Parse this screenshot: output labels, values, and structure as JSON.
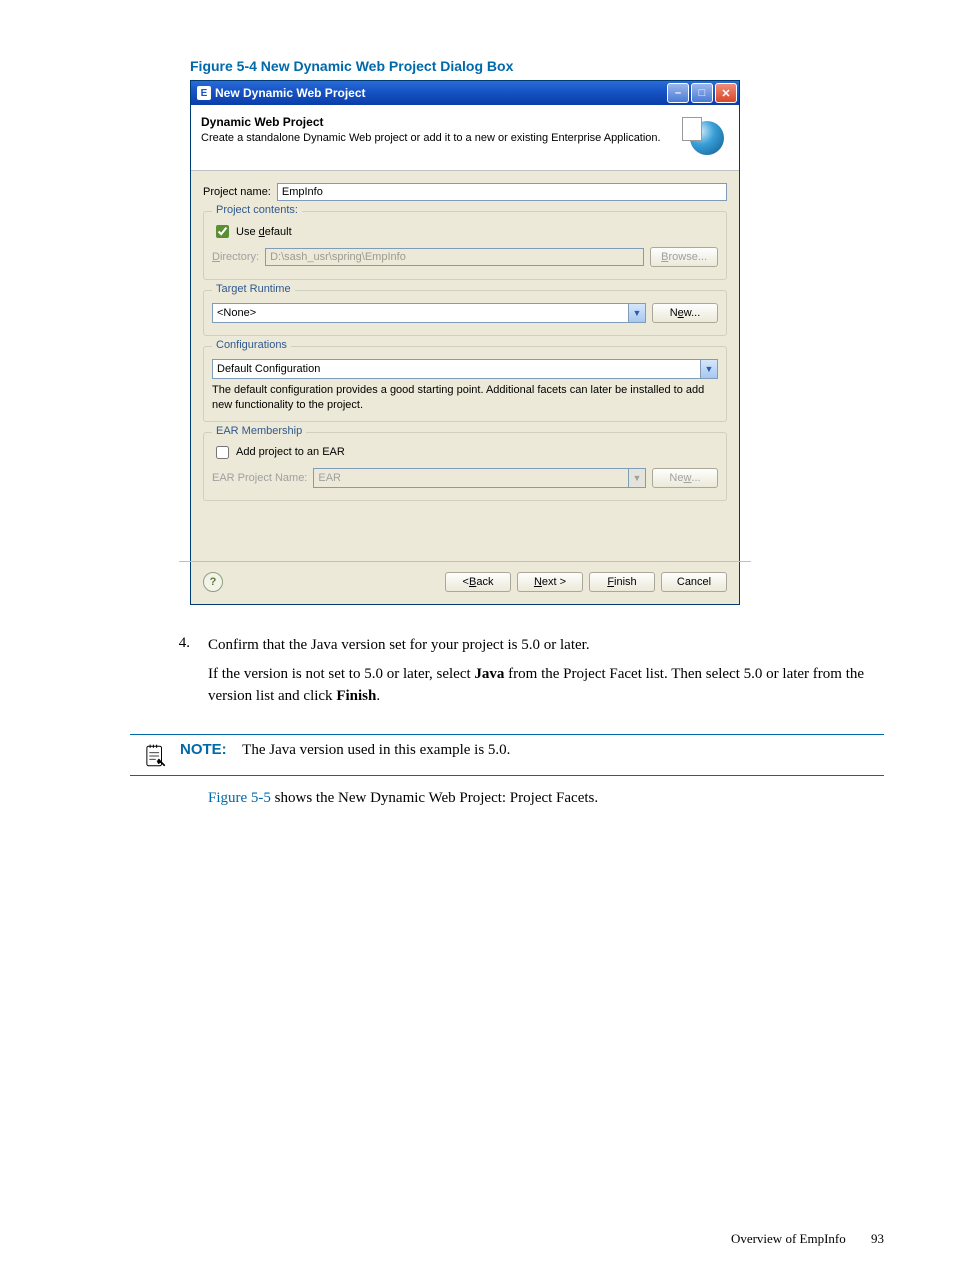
{
  "figure_caption": "Figure 5-4 New Dynamic Web Project Dialog Box",
  "dialog": {
    "window_title": "New Dynamic Web Project",
    "banner": {
      "title": "Dynamic Web Project",
      "desc": "Create a standalone Dynamic Web project or add it to a new or existing Enterprise Application."
    },
    "project_name_label": "Project name:",
    "project_name_value": "EmpInfo",
    "contents": {
      "legend": "Project contents:",
      "use_default_label_pre": "Use ",
      "use_default_label_u": "d",
      "use_default_label_post": "efault",
      "use_default_checked": true,
      "directory_label_u": "D",
      "directory_label_post": "irectory:",
      "directory_value": "D:\\sash_usr\\spring\\EmpInfo",
      "browse_label_u": "B",
      "browse_label_post": "rowse..."
    },
    "runtime": {
      "legend": "Target Runtime",
      "value": "<None>",
      "new_label_pre": "N",
      "new_label_u": "e",
      "new_label_post": "w..."
    },
    "config": {
      "legend": "Configurations",
      "value": "Default Configuration",
      "desc": "The default configuration provides a good starting point. Additional facets can later be installed to add new functionality to the project."
    },
    "ear": {
      "legend": "EAR Membership",
      "add_label": "Add project to an EAR",
      "add_checked": false,
      "name_label": "EAR Project Name:",
      "name_value": "EAR",
      "new_label_pre": "Ne",
      "new_label_u": "w",
      "new_label_post": "..."
    },
    "buttons": {
      "back_pre": "< ",
      "back_u": "B",
      "back_post": "ack",
      "next_u": "N",
      "next_post": "ext >",
      "finish_u": "F",
      "finish_post": "inish",
      "cancel": "Cancel"
    }
  },
  "step": {
    "num": "4.",
    "line1": "Confirm that the Java version set for your project is 5.0 or later.",
    "line2a": "If the version is not set to 5.0 or later, select ",
    "line2b": "Java",
    "line2c": " from the Project Facet list. Then select 5.0 or later from the version list and click ",
    "line2d": "Finish",
    "line2e": "."
  },
  "note": {
    "label": "NOTE:",
    "text": "The Java version used in this example is 5.0."
  },
  "after_note_ref": "Figure 5-5",
  "after_note_rest": " shows the New Dynamic Web Project: Project Facets.",
  "footer": {
    "section": "Overview of EmpInfo",
    "page": "93"
  }
}
